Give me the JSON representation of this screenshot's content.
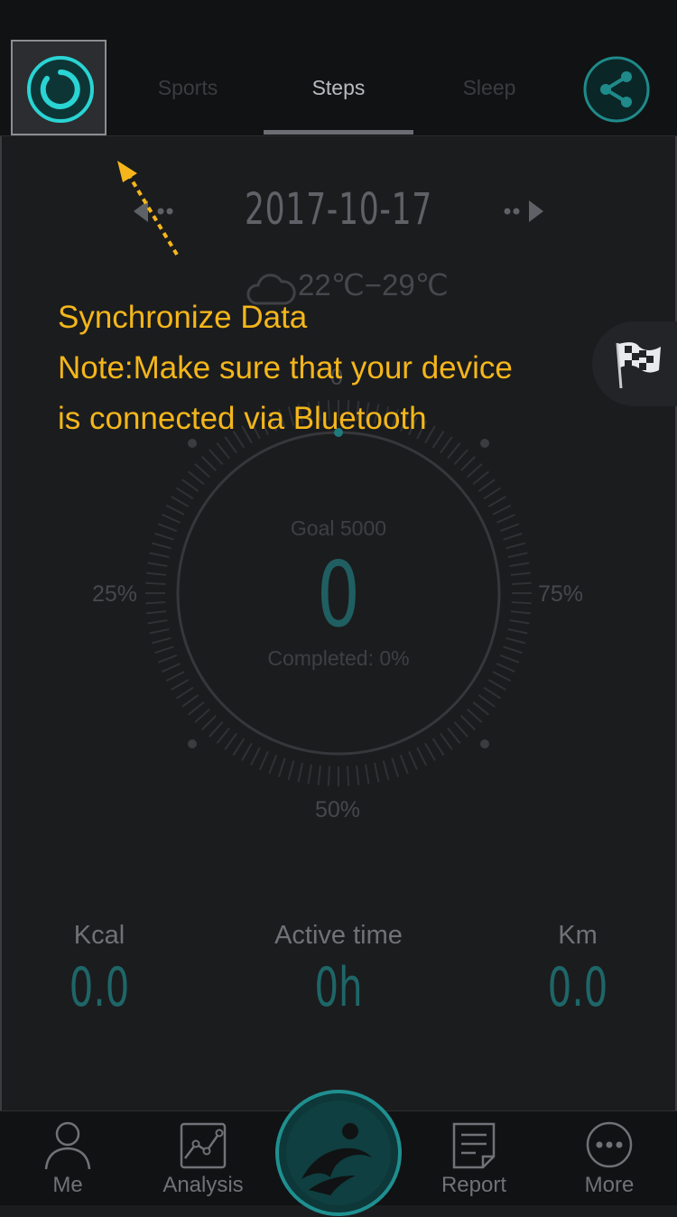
{
  "header": {
    "tabs": [
      {
        "label": "Sports",
        "active": false
      },
      {
        "label": "Steps",
        "active": true
      },
      {
        "label": "Sleep",
        "active": false
      }
    ],
    "sync_icon": "sync-ring-icon",
    "share_icon": "share-icon"
  },
  "date": {
    "value": "2017-10-17"
  },
  "weather": {
    "icon": "cloud-icon",
    "range": "22℃−29℃"
  },
  "dial": {
    "label_top": "0",
    "label_left": "25%",
    "label_right": "75%",
    "label_bottom": "50%",
    "goal": "Goal 5000",
    "steps": "0",
    "completed": "Completed: 0%",
    "progress": 0
  },
  "stats": [
    {
      "label": "Kcal",
      "value": "0.0"
    },
    {
      "label": "Active time",
      "value": "0h"
    },
    {
      "label": "Km",
      "value": "0.0"
    }
  ],
  "nav": [
    {
      "label": "Me",
      "icon": "person-icon"
    },
    {
      "label": "Analysis",
      "icon": "chart-icon"
    },
    {
      "label": "Report",
      "icon": "report-icon"
    },
    {
      "label": "More",
      "icon": "more-icon"
    }
  ],
  "overlay": {
    "line1": "Synchronize Data",
    "line2": "Note:Make sure that your device",
    "line3": "is connected via Bluetooth"
  },
  "colors": {
    "accent": "#2ad4d4",
    "tip": "#f4b61a",
    "background": "#1b1c1e"
  }
}
